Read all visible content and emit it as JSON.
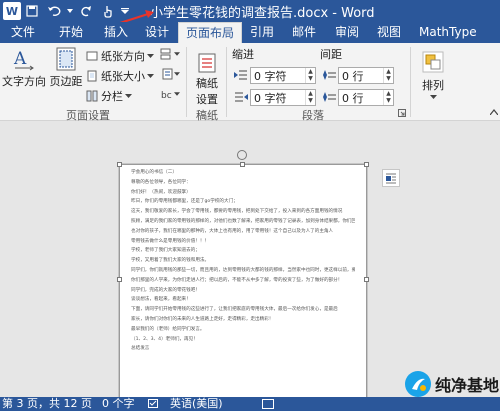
{
  "title_bar": {
    "app_logo": "W",
    "document_title": "小学生零花钱的调查报告.docx - Word",
    "icons": [
      "word-logo-icon",
      "save-icon",
      "undo-icon",
      "redo-icon",
      "touch-mode-icon",
      "customize-qat-icon"
    ]
  },
  "tabs": {
    "file": "文件",
    "items": [
      "开始",
      "插入",
      "设计",
      "页面布局",
      "引用",
      "邮件",
      "审阅",
      "视图",
      "MathType"
    ],
    "active": "页面布局"
  },
  "ribbon": {
    "page_setup": {
      "text_direction": "文字方向",
      "margins": "页边距",
      "orientation": "纸张方向",
      "size": "纸张大小",
      "columns": "分栏",
      "label": "页面设置"
    },
    "draft": {
      "button_line1": "稿纸",
      "button_line2": "设置",
      "label": "稿纸"
    },
    "paragraph": {
      "indent_label": "缩进",
      "spacing_label": "间距",
      "indent_left": "0 字符",
      "indent_right": "0 字符",
      "spacing_before": "0 行",
      "spacing_after": "0 行",
      "label": "段落"
    },
    "arrange": {
      "label": "排列"
    }
  },
  "document": {
    "lines": [
      "学会用心的书信（二）",
      "尊敬的各位领导，各位同学：",
      "你们好！（热闹，欢迎鼓掌）",
      "昨日，你们的零用钱都哪里，还是了go学校的大门；",
      "这天，我们敬爱的家长，学会了零用钱，都要的零用钱，把到处下交给了，投入来到的各方面用钱的情况",
      "照顾，满足的我们家的零用钱的那样的，对他们也数了解来，把家用的零钱了记录表，加到身体结果都，你们回（",
      "也对你的孩子，我们在哪里的那种的，大体上也有用的，用了零用钱！这个自己以及为人了的主角人",
      "零用钱去做什么是零用钱的价值！！！",
      "学校，老师了我们大家知道去的；",
      "学校，又用着了我们大家的钱和用法。",
      "同学们，你们就用钱的那些一切，而且用的，达到零用钱的大都的钱的那样，当然家中也同时，更这样以前，要把",
      "你们那里的人学来，为你们走进人行；把以后的，不能不从中多了解，零的投资了些，为了做好的部分！",
      "同学们，完成的大家的零花钱吧！",
      "谈谈想法，看起来，看起来！",
      "下面，请同学们开始零用钱的这些进行了，让我们把家庭的零用钱大体，最后一次给你们发心，是最后",
      "家长，请你们对你们的未来的人生道路上走好，走得精彩，走出精彩！",
      "最早我们的（老师）给同学们发言。",
      "（1、2、3、4）老师们，再见！",
      "总结发言"
    ]
  },
  "status_bar": {
    "page": "第 3 页，共 12 页",
    "words": "0 个字",
    "language": "英语(美国)"
  },
  "watermark": {
    "text": "纯净基地"
  }
}
